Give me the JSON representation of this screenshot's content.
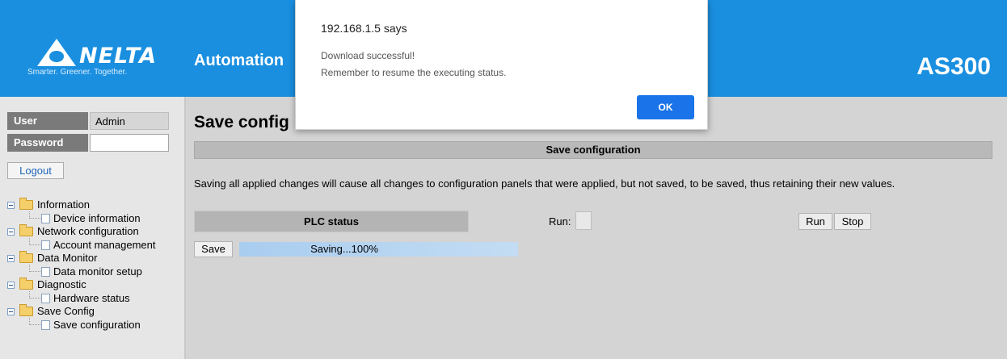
{
  "header": {
    "logo_text": "NELTA",
    "tagline": "Smarter. Greener. Together.",
    "title": "Automation",
    "model": "AS300",
    "color": "#1a8fe0"
  },
  "login": {
    "user_label": "User",
    "user_value": "Admin",
    "password_label": "Password",
    "password_value": "",
    "logout_label": "Logout"
  },
  "nav": [
    {
      "label": "Information",
      "children": [
        {
          "label": "Device information"
        }
      ]
    },
    {
      "label": "Network configuration",
      "children": [
        {
          "label": "Account management"
        }
      ]
    },
    {
      "label": "Data Monitor",
      "children": [
        {
          "label": "Data monitor setup"
        }
      ]
    },
    {
      "label": "Diagnostic",
      "children": [
        {
          "label": "Hardware status"
        }
      ]
    },
    {
      "label": "Save Config",
      "children": [
        {
          "label": "Save configuration"
        }
      ]
    }
  ],
  "main": {
    "page_title": "Save config",
    "section_title": "Save configuration",
    "description": "Saving all applied changes will cause all changes to configuration panels that were applied, but not saved, to be saved, thus retaining their new values.",
    "plc_status_label": "PLC status",
    "run_label": "Run:",
    "run_button": "Run",
    "stop_button": "Stop",
    "save_button": "Save",
    "progress_text": "Saving...100%",
    "progress": 1.0
  },
  "dialog": {
    "origin": "192.168.1.5 says",
    "line1": "Download successful!",
    "line2": "Remember to resume the executing status.",
    "ok_label": "OK",
    "ok_color": "#1a73e8"
  }
}
